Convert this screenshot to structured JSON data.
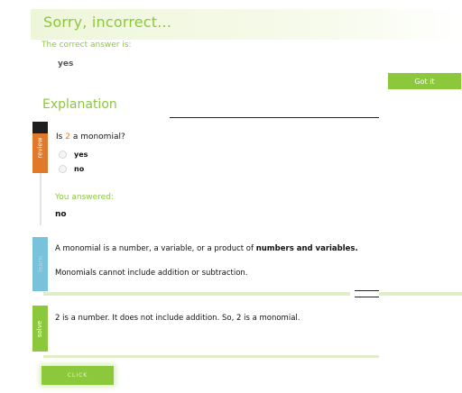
{
  "feedback": {
    "title": "Sorry, incorrect...",
    "correct_label": "The correct answer is:",
    "correct_value": "yes",
    "got_it_label": "Got it"
  },
  "explanation": {
    "heading": "Explanation"
  },
  "review": {
    "tab_label": "review",
    "question_prefix": "Is ",
    "question_number": "2",
    "question_suffix": " a monomial?",
    "options": [
      "yes",
      "no"
    ],
    "you_answered_label": "You answered:",
    "you_answered_value": "no"
  },
  "learn": {
    "tab_label": "learn",
    "line1_a": "A monomial is a number, a variable, or a product of ",
    "line1_b": "numbers and variables.",
    "line2": "Monomials cannot include addition or subtraction."
  },
  "solve": {
    "tab_label": "solve",
    "text": "2 is a number. It does not include addition. So, 2 is a monomial."
  },
  "footer": {
    "continue_label": "CLICK"
  },
  "colors": {
    "accent_green": "#8cc83c",
    "review_orange": "#e07a2a",
    "learn_blue": "#79c2dc"
  }
}
